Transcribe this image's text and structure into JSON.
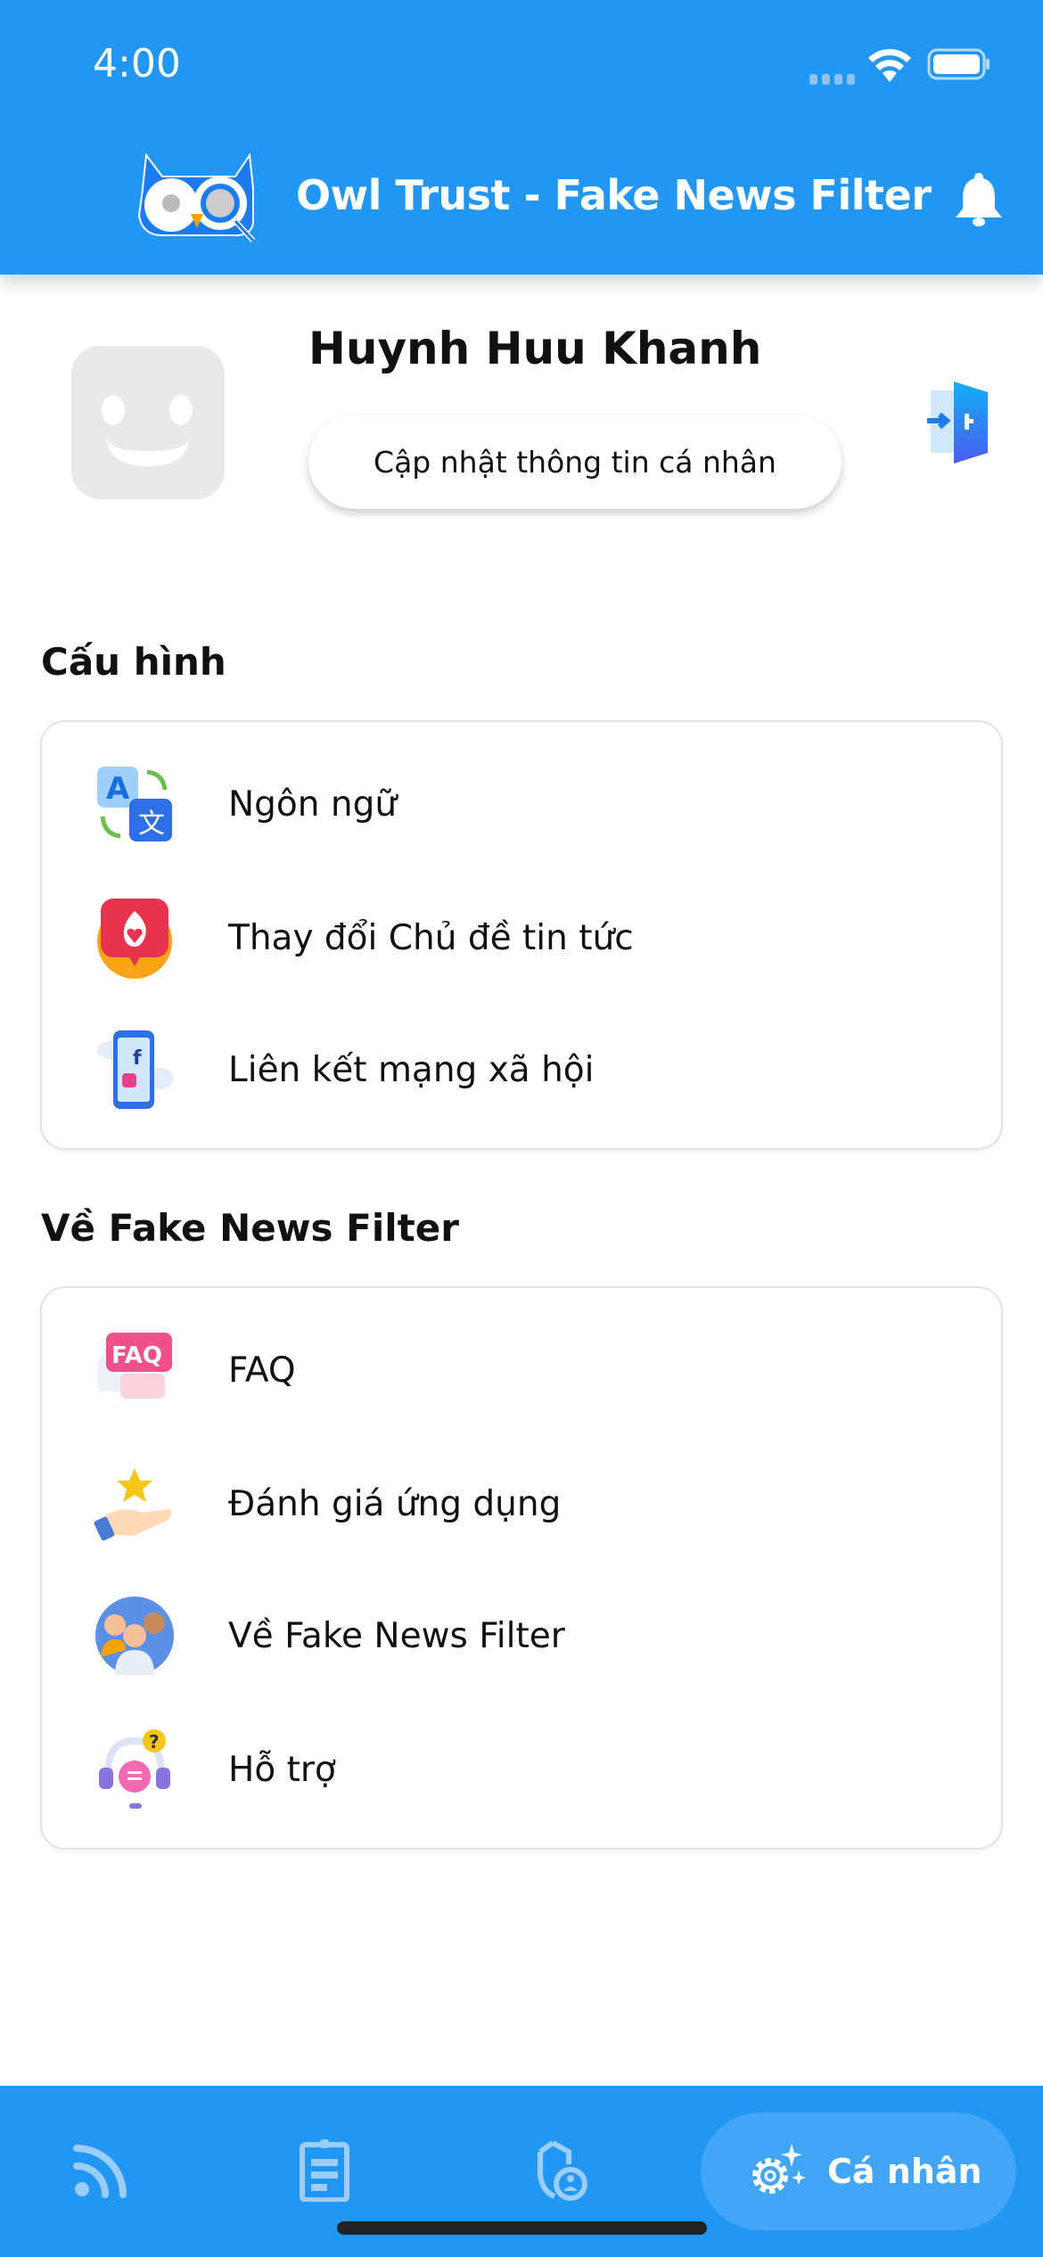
{
  "status_bar": {
    "time": "4:00"
  },
  "header": {
    "title": "Owl Trust - Fake News Filter",
    "notification_icon": "bell-icon"
  },
  "profile": {
    "name": "Huynh Huu Khanh",
    "update_button": "Cập nhật thông tin cá nhân",
    "logout_icon": "logout-door-icon"
  },
  "config": {
    "title": "Cấu hình",
    "items": [
      {
        "label": "Ngôn ngữ",
        "icon": "translate-icon"
      },
      {
        "label": "Thay đổi Chủ đề tin tức",
        "icon": "topic-heart-icon"
      },
      {
        "label": "Liên kết mạng xã hội",
        "icon": "social-phone-icon"
      }
    ]
  },
  "about": {
    "title": "Về Fake News Filter",
    "items": [
      {
        "label": "FAQ",
        "icon": "faq-icon"
      },
      {
        "label": "Đánh giá ứng dụng",
        "icon": "rate-star-hand-icon"
      },
      {
        "label": "Về Fake News Filter",
        "icon": "team-icon"
      },
      {
        "label": "Hỗ trợ",
        "icon": "support-headset-icon"
      }
    ]
  },
  "bottom_nav": {
    "items": [
      {
        "icon": "rss-feed-icon"
      },
      {
        "icon": "clipboard-icon"
      },
      {
        "icon": "shield-user-icon"
      },
      {
        "icon": "gear-sparkle-icon",
        "label": "Cá nhân",
        "active": true
      }
    ]
  },
  "colors": {
    "primary": "#2196F3",
    "active_tab": "#42A5F5"
  }
}
